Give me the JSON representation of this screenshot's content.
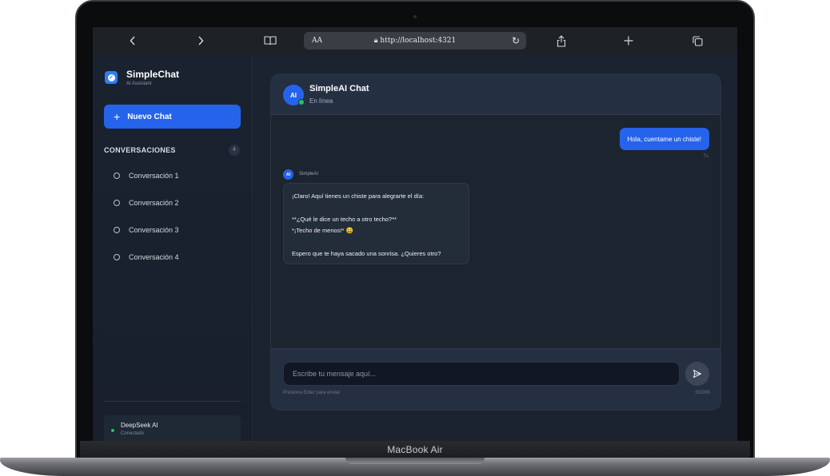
{
  "device": {
    "label": "MacBook Air"
  },
  "browser": {
    "url": "http://localhost:4321",
    "reader_label": "AA",
    "icons": [
      "chevron-left-icon",
      "chevron-right-icon",
      "book-icon",
      "lock-icon",
      "reload-icon",
      "share-icon",
      "plus-icon",
      "tabs-icon"
    ]
  },
  "sidebar": {
    "brand": "SimpleChat",
    "brand_sub": "AI Assistant",
    "new_chat": "Nuevo Chat",
    "conversations_header": "CONVERSACIONES",
    "conversations_count": "4",
    "conversations": [
      {
        "label": "Conversación 1"
      },
      {
        "label": "Conversación 2"
      },
      {
        "label": "Conversación 3"
      },
      {
        "label": "Conversación 4"
      }
    ],
    "model": {
      "name": "DeepSeek AI",
      "status": "Conectado"
    }
  },
  "chat": {
    "title": "SimpleAI Chat",
    "status": "En línea",
    "avatar": "AI",
    "messages": [
      {
        "role": "user",
        "text": "Hola, cuentame un chiste!",
        "tag": "Tu"
      },
      {
        "role": "assistant",
        "name": "SimpleAI",
        "lines": [
          "¡Claro! Aquí tienes un chiste para alegrarte el día:",
          "",
          "**¿Qué le dice un techo a otro techo?**",
          "*¡Techo de menos!* 😄",
          "",
          "Espero que te haya sacado una sonrisa. ¿Quieres otro?"
        ]
      }
    ],
    "input_placeholder": "Escribe tu mensaje aquí...",
    "hint": "Presiona Enter para enviar",
    "counter": "0/1000"
  },
  "colors": {
    "accent": "#2563eb",
    "online": "#22c55e",
    "background": "#1b2330"
  }
}
